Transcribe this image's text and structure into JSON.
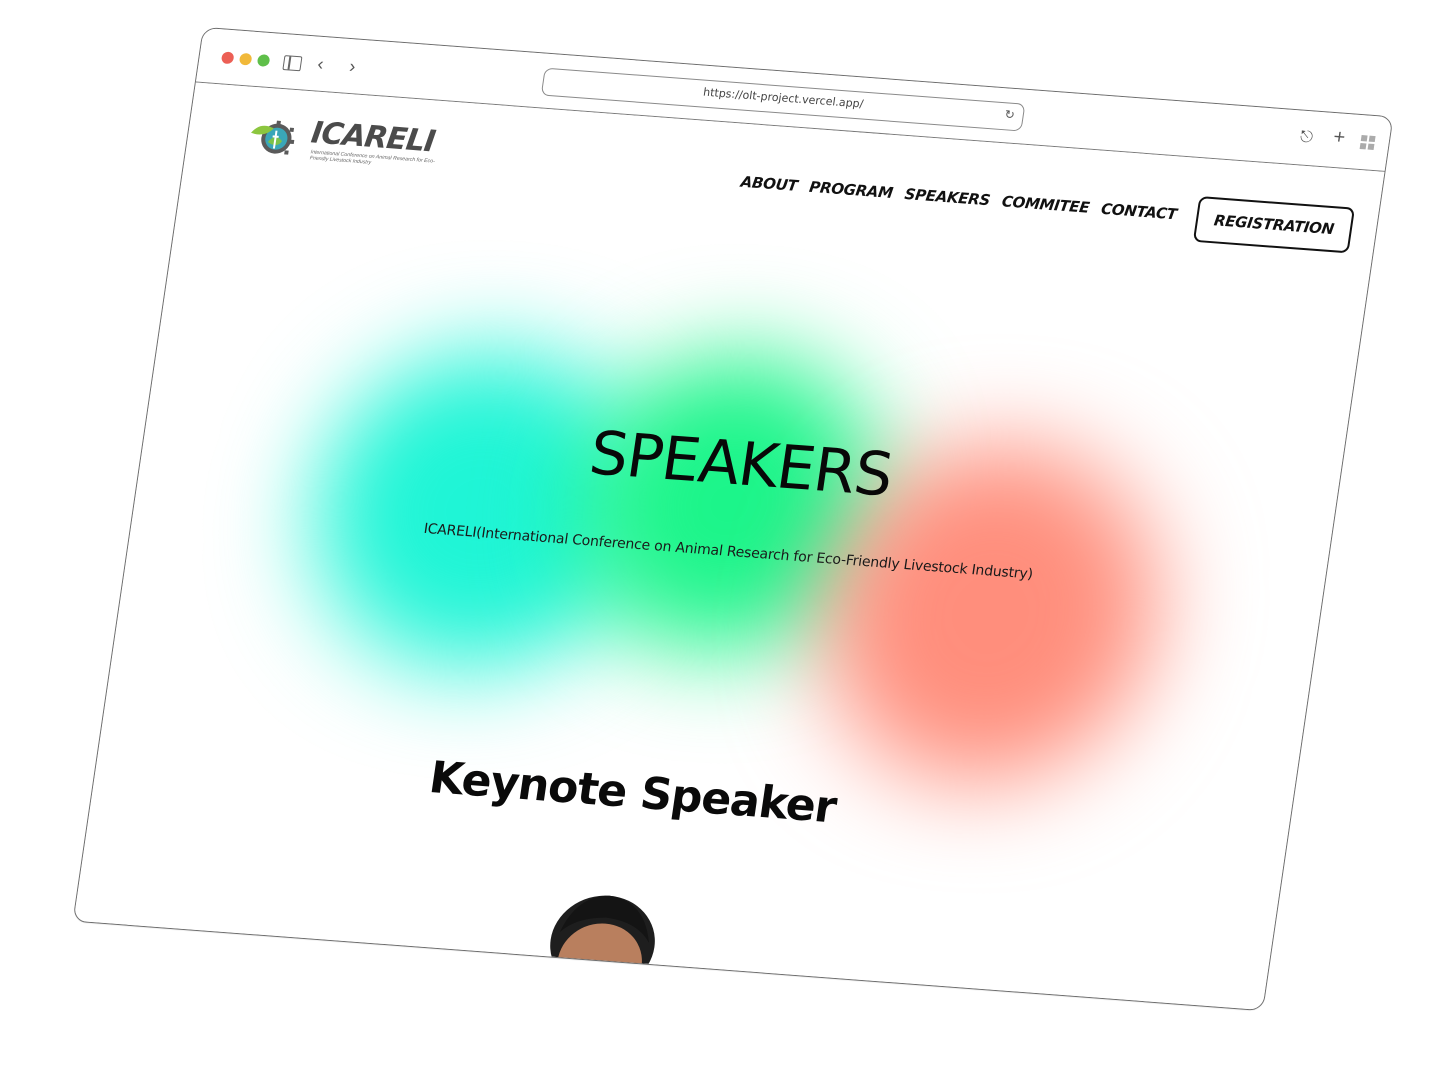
{
  "browser": {
    "url": "https://olt-project.vercel.app/"
  },
  "header": {
    "logo_text": "ICARELI",
    "logo_subtitle": "International Conference on Animal Research for Eco-Friendly Livestock Industry",
    "nav": [
      {
        "label": "ABOUT"
      },
      {
        "label": "PROGRAM"
      },
      {
        "label": "SPEAKERS"
      },
      {
        "label": "COMMITEE"
      },
      {
        "label": "CONTACT"
      }
    ],
    "registration_label": "REGISTRATION"
  },
  "hero": {
    "title": "SPEAKERS",
    "subtitle": "ICARELI(International Conference on Animal Research for Eco-Friendly Livestock Industry)",
    "colors": {
      "cyan": "#1ff5d6",
      "green": "#1cf58a",
      "red": "#ff8e7c"
    }
  },
  "keynote": {
    "heading": "Keynote Speaker"
  }
}
